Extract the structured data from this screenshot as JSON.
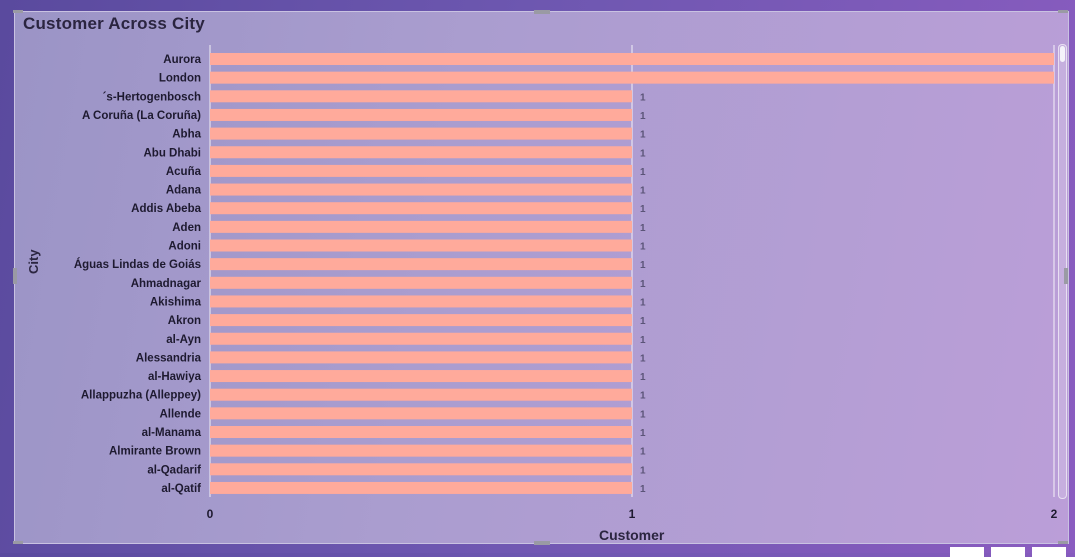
{
  "title": "Customer Across City",
  "chart_data": {
    "type": "bar",
    "orientation": "horizontal",
    "title": "Customer Across City",
    "xlabel": "Customer",
    "ylabel": "City",
    "xlim": [
      0,
      2
    ],
    "xticks": [
      "0",
      "1",
      "2"
    ],
    "categories": [
      "Aurora",
      "London",
      "´s-Hertogenbosch",
      "A Coruña (La Coruña)",
      "Abha",
      "Abu Dhabi",
      "Acuña",
      "Adana",
      "Addis Abeba",
      "Aden",
      "Adoni",
      "Águas Lindas de Goiás",
      "Ahmadnagar",
      "Akishima",
      "Akron",
      "al-Ayn",
      "Alessandria",
      "al-Hawiya",
      "Allappuzha (Alleppey)",
      "Allende",
      "al-Manama",
      "Almirante Brown",
      "al-Qadarif",
      "al-Qatif"
    ],
    "values": [
      2,
      2,
      1,
      1,
      1,
      1,
      1,
      1,
      1,
      1,
      1,
      1,
      1,
      1,
      1,
      1,
      1,
      1,
      1,
      1,
      1,
      1,
      1,
      1
    ],
    "data_labels": [
      "",
      "",
      "1",
      "1",
      "1",
      "1",
      "1",
      "1",
      "1",
      "1",
      "1",
      "1",
      "1",
      "1",
      "1",
      "1",
      "1",
      "1",
      "1",
      "1",
      "1",
      "1",
      "1",
      "1"
    ],
    "bar_color": "#ffaa9b",
    "grid": true,
    "legend": "none"
  }
}
